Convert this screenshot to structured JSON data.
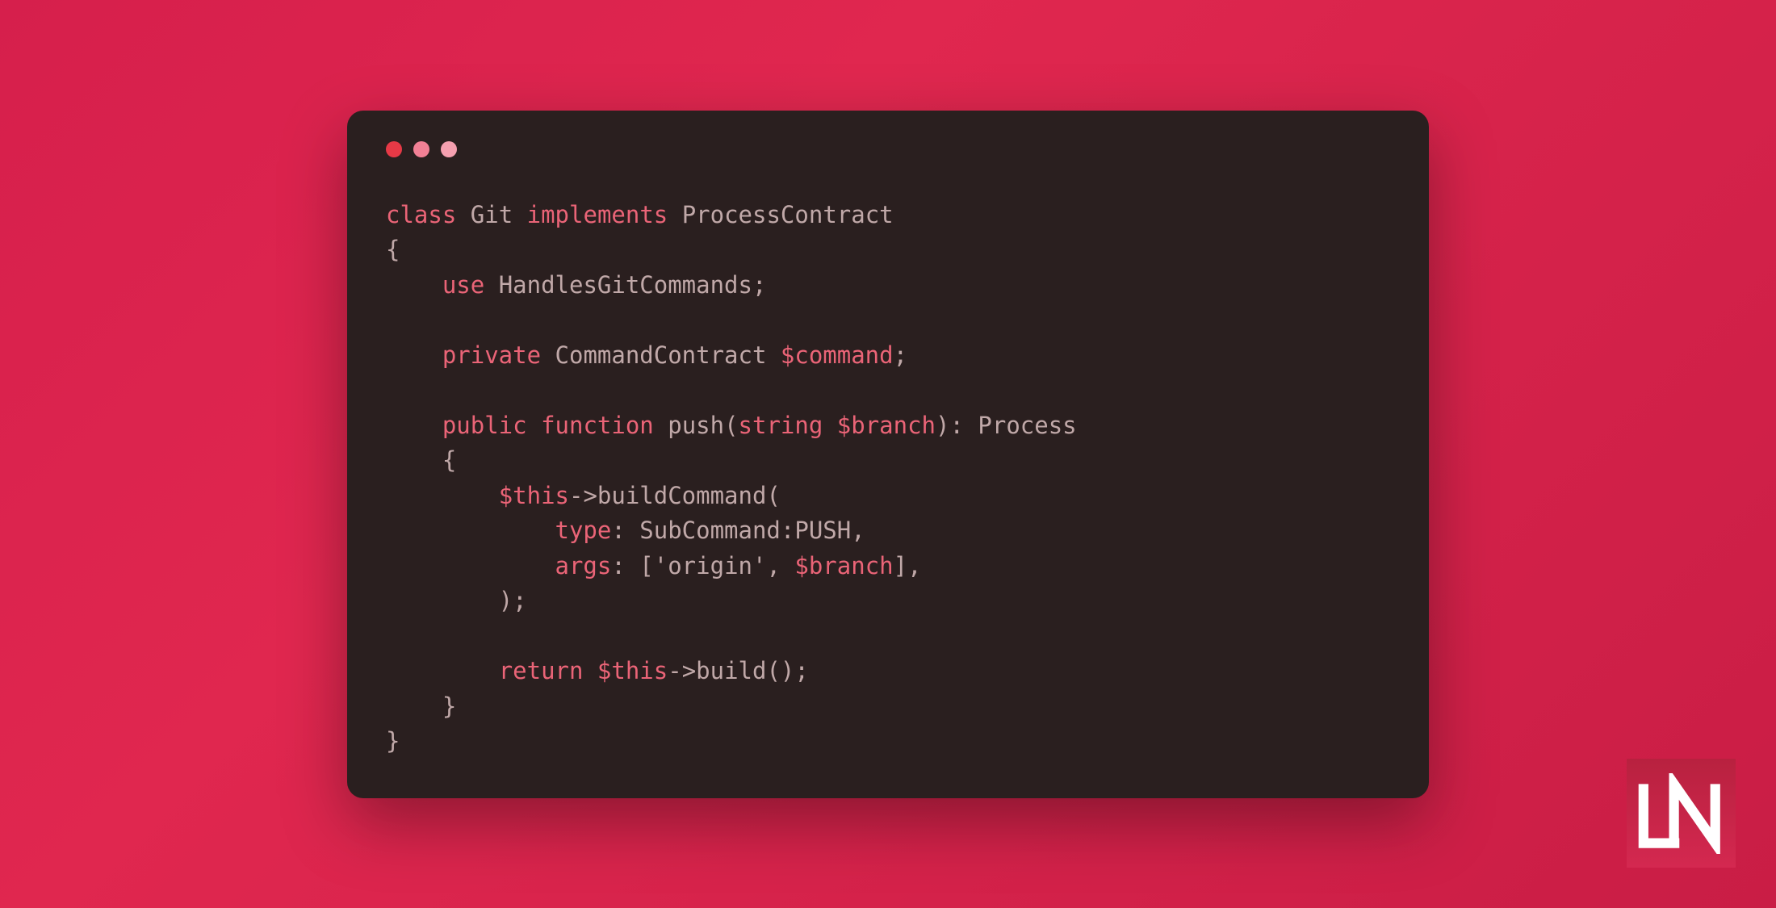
{
  "code": {
    "line1_class": "class",
    "line1_classname": "Git",
    "line1_implements": "implements",
    "line1_interface": "ProcessContract",
    "line2_brace": "{",
    "line3_use": "use",
    "line3_trait": "HandlesGitCommands",
    "line3_semi": ";",
    "line5_private": "private",
    "line5_type": "CommandContract",
    "line5_var": "$command",
    "line5_semi": ";",
    "line7_public": "public",
    "line7_function": "function",
    "line7_name": "push",
    "line7_paren_open": "(",
    "line7_paramtype": "string",
    "line7_paramvar": "$branch",
    "line7_paren_close": ")",
    "line7_colon": ":",
    "line7_returntype": "Process",
    "line8_brace": "{",
    "line9_this": "$this",
    "line9_arrow": "->",
    "line9_method": "buildCommand",
    "line9_paren": "(",
    "line10_label": "type",
    "line10_colon": ":",
    "line10_class": "SubCommand",
    "line10_sep": ":",
    "line10_const": "PUSH",
    "line10_comma": ",",
    "line11_label": "args",
    "line11_colon": ":",
    "line11_bracket_open": "[",
    "line11_string": "'origin'",
    "line11_comma1": ",",
    "line11_var": "$branch",
    "line11_bracket_close": "]",
    "line11_comma2": ",",
    "line12_close": ");",
    "line14_return": "return",
    "line14_this": "$this",
    "line14_arrow": "->",
    "line14_method": "build",
    "line14_call": "();",
    "line15_brace": "}",
    "line16_brace": "}"
  },
  "colors": {
    "bg_gradient_start": "#d61f4c",
    "bg_gradient_end": "#c91d45",
    "window_bg": "#2a1f1f",
    "keyword": "#ea6477",
    "text": "#c0a8a8",
    "dot_close": "#e63946",
    "dot_min": "#f28095",
    "dot_max": "#f5a0b0"
  },
  "logo": {
    "text": "LN"
  }
}
